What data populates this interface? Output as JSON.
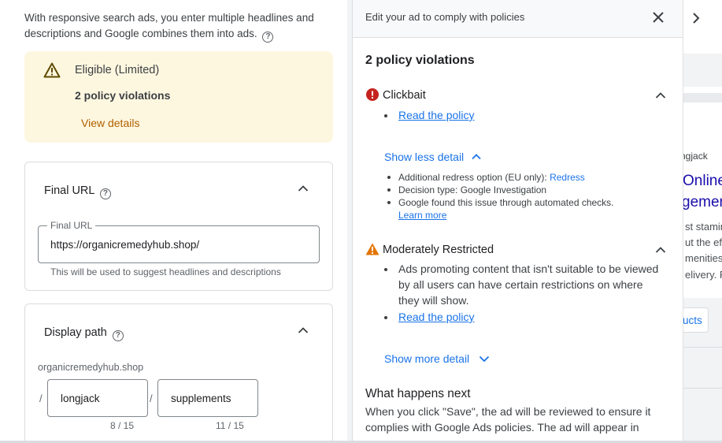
{
  "intro": {
    "text": "With responsive search ads, you enter multiple headlines and descriptions and Google combines them into ads."
  },
  "eligibility": {
    "status": "Eligible (Limited)",
    "violations": "2 policy violations",
    "view_details": "View details",
    "warning_color": "#b06000"
  },
  "final_url": {
    "title": "Final URL",
    "field_label": "Final URL",
    "value": "https://organicremedyhub.shop/",
    "hint": "This will be used to suggest headlines and descriptions"
  },
  "display_path": {
    "title": "Display path",
    "domain": "organicremedyhub.shop",
    "separator": "/",
    "path1": "longjack",
    "path2": "supplements",
    "path1_count": "8 / 15",
    "path2_count": "11 / 15"
  },
  "policy_panel": {
    "header": "Edit your ad to comply with policies",
    "heading": "2 policy violations",
    "violations": [
      {
        "title": "Clickbait",
        "severity_icon": "error-icon",
        "read_policy": "Read the policy",
        "toggle": "Show less detail",
        "details": {
          "redress_label": "Additional redress option (EU only): ",
          "redress_link": "Redress",
          "decision": "Decision type: Google Investigation",
          "found": "Google found this issue through automated checks.",
          "learn_more": "Learn more"
        }
      },
      {
        "title": "Moderately Restricted",
        "severity_icon": "warning-icon",
        "description": "Ads promoting content that isn't suitable to be viewed by all users can have certain restrictions on where they will show.",
        "read_policy": "Read the policy",
        "toggle": "Show more detail"
      }
    ],
    "what_next": {
      "title": "What happens next",
      "body": "When you click \"Save\", the ad will be reviewed to ensure it complies with Google Ads policies. The ad will appear in"
    }
  },
  "preview": {
    "label": "ngjack",
    "headline1": "Online",
    "headline2": "gemen",
    "desc1": "st stamin",
    "desc2": "ut the ef",
    "desc3": "menities",
    "desc4": "elivery. F",
    "chip": "ucts"
  },
  "colors": {
    "accent": "#1a73e8",
    "error": "#d93025",
    "warning": "#e37400",
    "eligible_bg": "#fef7e0"
  }
}
